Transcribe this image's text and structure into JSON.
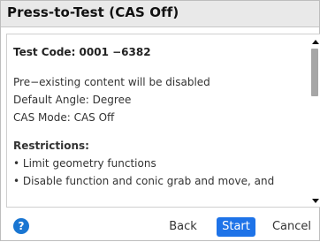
{
  "title": "Press-to-Test (CAS Off)",
  "content": {
    "test_code": "Test Code: 0001 −6382",
    "lines": [
      "Pre−existing content will be disabled",
      "Default Angle: Degree",
      "CAS Mode: CAS Off"
    ],
    "restrictions_heading": "Restrictions:",
    "bullets": [
      "• Limit geometry functions",
      "• Disable function and conic grab and move, and"
    ]
  },
  "footer": {
    "help_label": "?",
    "back_label": "Back",
    "start_label": "Start",
    "cancel_label": "Cancel",
    "accent_color": "#1e73e8"
  }
}
